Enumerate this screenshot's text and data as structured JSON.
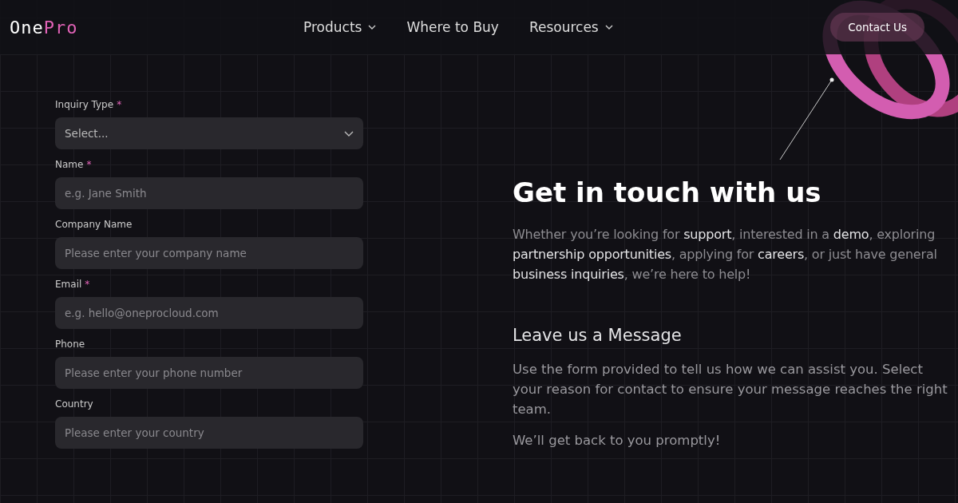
{
  "header": {
    "logo": "One**Pro**",
    "nav": [
      {
        "label": "Products",
        "dropdown": true
      },
      {
        "label": "Where to Buy",
        "dropdown": false
      },
      {
        "label": "Resources",
        "dropdown": true
      }
    ],
    "cta": "Contact Us"
  },
  "form": {
    "required_mark": "*",
    "fields": [
      {
        "kind": "select",
        "label": "Inquiry Type",
        "required": true,
        "placeholder": "Select..."
      },
      {
        "kind": "text",
        "label": "Name",
        "required": true,
        "placeholder": "e.g. Jane Smith"
      },
      {
        "kind": "text",
        "label": "Company Name",
        "required": false,
        "placeholder": "Please enter your company name"
      },
      {
        "kind": "text",
        "label": "Email",
        "required": true,
        "placeholder": "e.g. hello@oneprocloud.com"
      },
      {
        "kind": "text",
        "label": "Phone",
        "required": false,
        "placeholder": "Please enter your phone number"
      },
      {
        "kind": "text",
        "label": "Country",
        "required": false,
        "placeholder": "Please enter your country"
      }
    ]
  },
  "intro": {
    "heading": "Get in touch with us",
    "text": "Whether you’re looking for **support**, interested in a **demo**, exploring **partnership opportunities**, applying for **careers**, or just have general **business inquiries**, we’re here to help!",
    "subheading": "Leave us a Message",
    "paragraphs": [
      "Use the form provided to tell us how we can assist you. Select your reason for contact to ensure your message reaches the right team.",
      "We’ll get back to you promptly!"
    ]
  }
}
